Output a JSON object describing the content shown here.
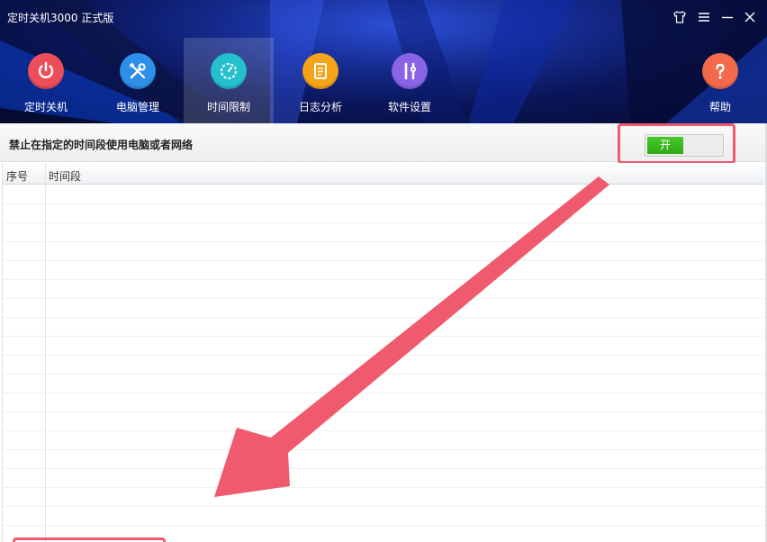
{
  "app": {
    "title": "定时关机3000 正式版"
  },
  "window_controls": [
    {
      "name": "skin",
      "icon": "shirt-icon"
    },
    {
      "name": "menu",
      "icon": "menu-icon"
    },
    {
      "name": "minimize",
      "icon": "minimize-icon"
    },
    {
      "name": "close",
      "icon": "close-icon"
    }
  ],
  "nav": [
    {
      "label": "定时关机",
      "icon": "power-icon",
      "color": "#ec4f5a",
      "active": false
    },
    {
      "label": "电脑管理",
      "icon": "tools-icon",
      "color": "#2e8fe8",
      "active": false
    },
    {
      "label": "时间限制",
      "icon": "timer-icon",
      "color": "#25c0cd",
      "active": true
    },
    {
      "label": "日志分析",
      "icon": "log-icon",
      "color": "#f5a317",
      "active": false
    },
    {
      "label": "软件设置",
      "icon": "settings-icon",
      "color": "#8b63e6",
      "active": false
    },
    {
      "label": "帮助",
      "icon": "help-icon",
      "color": "#f26a4b",
      "active": false
    }
  ],
  "rule": {
    "text": "禁止在指定的时间段使用电脑或者网络",
    "toggle_label": "开",
    "toggle_on": true,
    "toggle_color": "#3cbb1f"
  },
  "table": {
    "columns": [
      "序号",
      "时间段"
    ],
    "rows": []
  },
  "annotation": {
    "color": "#f05a6e"
  }
}
